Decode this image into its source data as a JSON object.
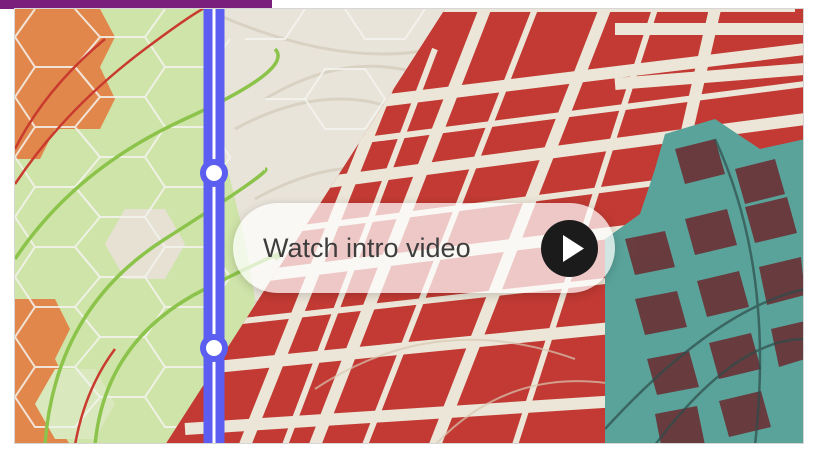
{
  "intro_video": {
    "label": "Watch intro video",
    "play_icon": "play-icon"
  },
  "colors": {
    "accent_bar": "#7b1f7d",
    "green_hex": "#cfe4a9",
    "orange_hex": "#e2874c",
    "red_blocks": "#c23a33",
    "teal_hex": "#5aa39a",
    "blue_line": "#5b5ef0",
    "pill_bg": "rgba(255,255,255,0.72)",
    "play_bg": "#1b1b1b"
  }
}
